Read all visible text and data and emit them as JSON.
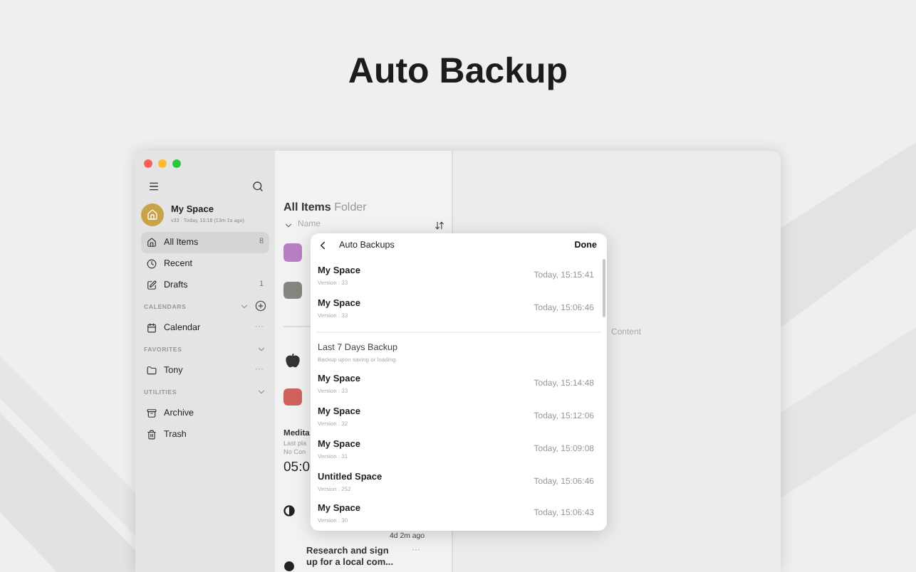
{
  "headline": "Auto Backup",
  "sidebar": {
    "space": {
      "name": "My Space",
      "meta": "v33 · Today, 15:18 (13m 1s ago)"
    },
    "items": [
      {
        "label": "All Items",
        "count": "8",
        "selected": true
      },
      {
        "label": "Recent",
        "selected": false
      },
      {
        "label": "Drafts",
        "count": "1",
        "selected": false
      }
    ],
    "sections": [
      {
        "title": "CALENDARS",
        "add": true,
        "items": [
          {
            "label": "Calendar",
            "more": "···"
          }
        ]
      },
      {
        "title": "FAVORITES",
        "items": [
          {
            "label": "Tony",
            "more": "···"
          }
        ]
      },
      {
        "title": "UTILITIES",
        "items": [
          {
            "label": "Archive"
          },
          {
            "label": "Trash"
          }
        ]
      }
    ]
  },
  "list": {
    "title": "All Items",
    "subtitle": "Folder",
    "sort_label": "Name",
    "entries": [
      {
        "kind": "tile",
        "color": "#b97fc4"
      },
      {
        "kind": "tile",
        "color": "#86857f"
      },
      {
        "kind": "divider"
      },
      {
        "kind": "apple"
      },
      {
        "kind": "tile",
        "color": "#d0625e"
      },
      {
        "kind": "text",
        "title": "Medita",
        "lines": [
          "Last pla",
          "No Con"
        ],
        "big": "05:0"
      },
      {
        "kind": "timer",
        "ago": "4d 2m ago"
      },
      {
        "kind": "note",
        "title": "Research and sign up for a local com...",
        "more": "···"
      }
    ]
  },
  "content": {
    "placeholder": "Content"
  },
  "popup": {
    "title": "Auto Backups",
    "done": "Done",
    "recent": [
      {
        "name": "My Space",
        "version": "Version : 33",
        "time": "Today, 15:15:41"
      },
      {
        "name": "My Space",
        "version": "Version : 33",
        "time": "Today, 15:06:46"
      }
    ],
    "section": {
      "title": "Last 7 Days Backup",
      "note": "Backup upon saving or loading."
    },
    "older": [
      {
        "name": "My Space",
        "version": "Version : 33",
        "time": "Today, 15:14:48"
      },
      {
        "name": "My Space",
        "version": "Version : 32",
        "time": "Today, 15:12:06"
      },
      {
        "name": "My Space",
        "version": "Version : 31",
        "time": "Today, 15:09:08"
      },
      {
        "name": "Untitled Space",
        "version": "Version : 252",
        "time": "Today, 15:06:46"
      },
      {
        "name": "My Space",
        "version": "Version : 30",
        "time": "Today, 15:06:43"
      }
    ]
  }
}
